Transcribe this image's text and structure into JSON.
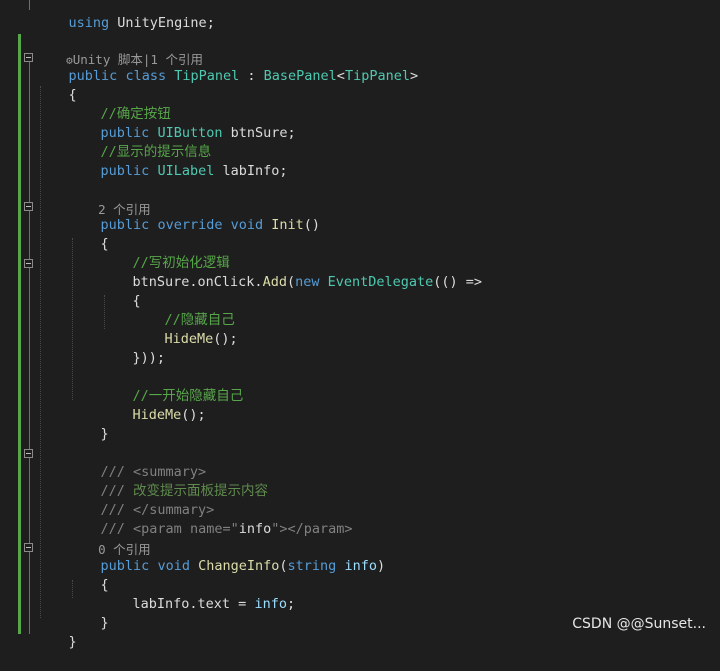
{
  "code": {
    "l00": {
      "a": "using",
      "b": " UnityEngine;"
    },
    "lens1": {
      "icon": "⚙",
      "text": "Unity 脚本|1 个引用"
    },
    "l01": {
      "a": "public",
      "b": " ",
      "c": "class",
      "d": " ",
      "e": "TipPanel",
      "f": " : ",
      "g": "BasePanel",
      "h": "<",
      "i": "TipPanel",
      "j": ">"
    },
    "l02": {
      "a": "{"
    },
    "l03": {
      "a": "//确定按钮"
    },
    "l04": {
      "a": "public",
      "b": " ",
      "c": "UIButton",
      "d": " btnSure;"
    },
    "l05": {
      "a": "//显示的提示信息"
    },
    "l06": {
      "a": "public",
      "b": " ",
      "c": "UILabel",
      "d": " labInfo;"
    },
    "lens2": {
      "text": "2 个引用"
    },
    "l07": {
      "a": "public",
      "b": " ",
      "c": "override",
      "d": " ",
      "e": "void",
      "f": " ",
      "g": "Init",
      "h": "()"
    },
    "l08": {
      "a": "{"
    },
    "l09": {
      "a": "//写初始化逻辑"
    },
    "l10": {
      "a": "btnSure.onClick.",
      "b": "Add",
      "c": "(",
      "d": "new",
      "e": " ",
      "f": "EventDelegate",
      "g": "(() =>"
    },
    "l11": {
      "a": "{"
    },
    "l12": {
      "a": "//隐藏自己"
    },
    "l13": {
      "a": "HideMe",
      "b": "();"
    },
    "l14": {
      "a": "}));"
    },
    "l15": {
      "a": "//一开始隐藏自己"
    },
    "l16": {
      "a": "HideMe",
      "b": "();"
    },
    "l17": {
      "a": "}"
    },
    "l18": {
      "a": "/// ",
      "b": "<summary>"
    },
    "l19": {
      "a": "/// ",
      "b": "改变提示面板提示内容"
    },
    "l20": {
      "a": "/// ",
      "b": "</summary>"
    },
    "l21": {
      "a": "/// ",
      "b": "<param",
      "c": " name",
      "d": "=\"",
      "e": "info",
      "f": "\"",
      "g": "></param>"
    },
    "lens3": {
      "text": "0 个引用"
    },
    "l22": {
      "a": "public",
      "b": " ",
      "c": "void",
      "d": " ",
      "e": "ChangeInfo",
      "f": "(",
      "g": "string",
      "h": " ",
      "i": "info",
      "j": ")"
    },
    "l23": {
      "a": "{"
    },
    "l24": {
      "a": "labInfo.text = ",
      "b": "info",
      "c": ";"
    },
    "l25": {
      "a": "}"
    },
    "l26": {
      "a": "}"
    }
  },
  "watermark": "CSDN @@Sunset...",
  "colors": {
    "background": "#1e1e1e",
    "keyword": "#569cd6",
    "type": "#4ec9b0",
    "comment": "#57a64a",
    "method": "#dcdcaa",
    "change_bar": "#57a64a"
  }
}
